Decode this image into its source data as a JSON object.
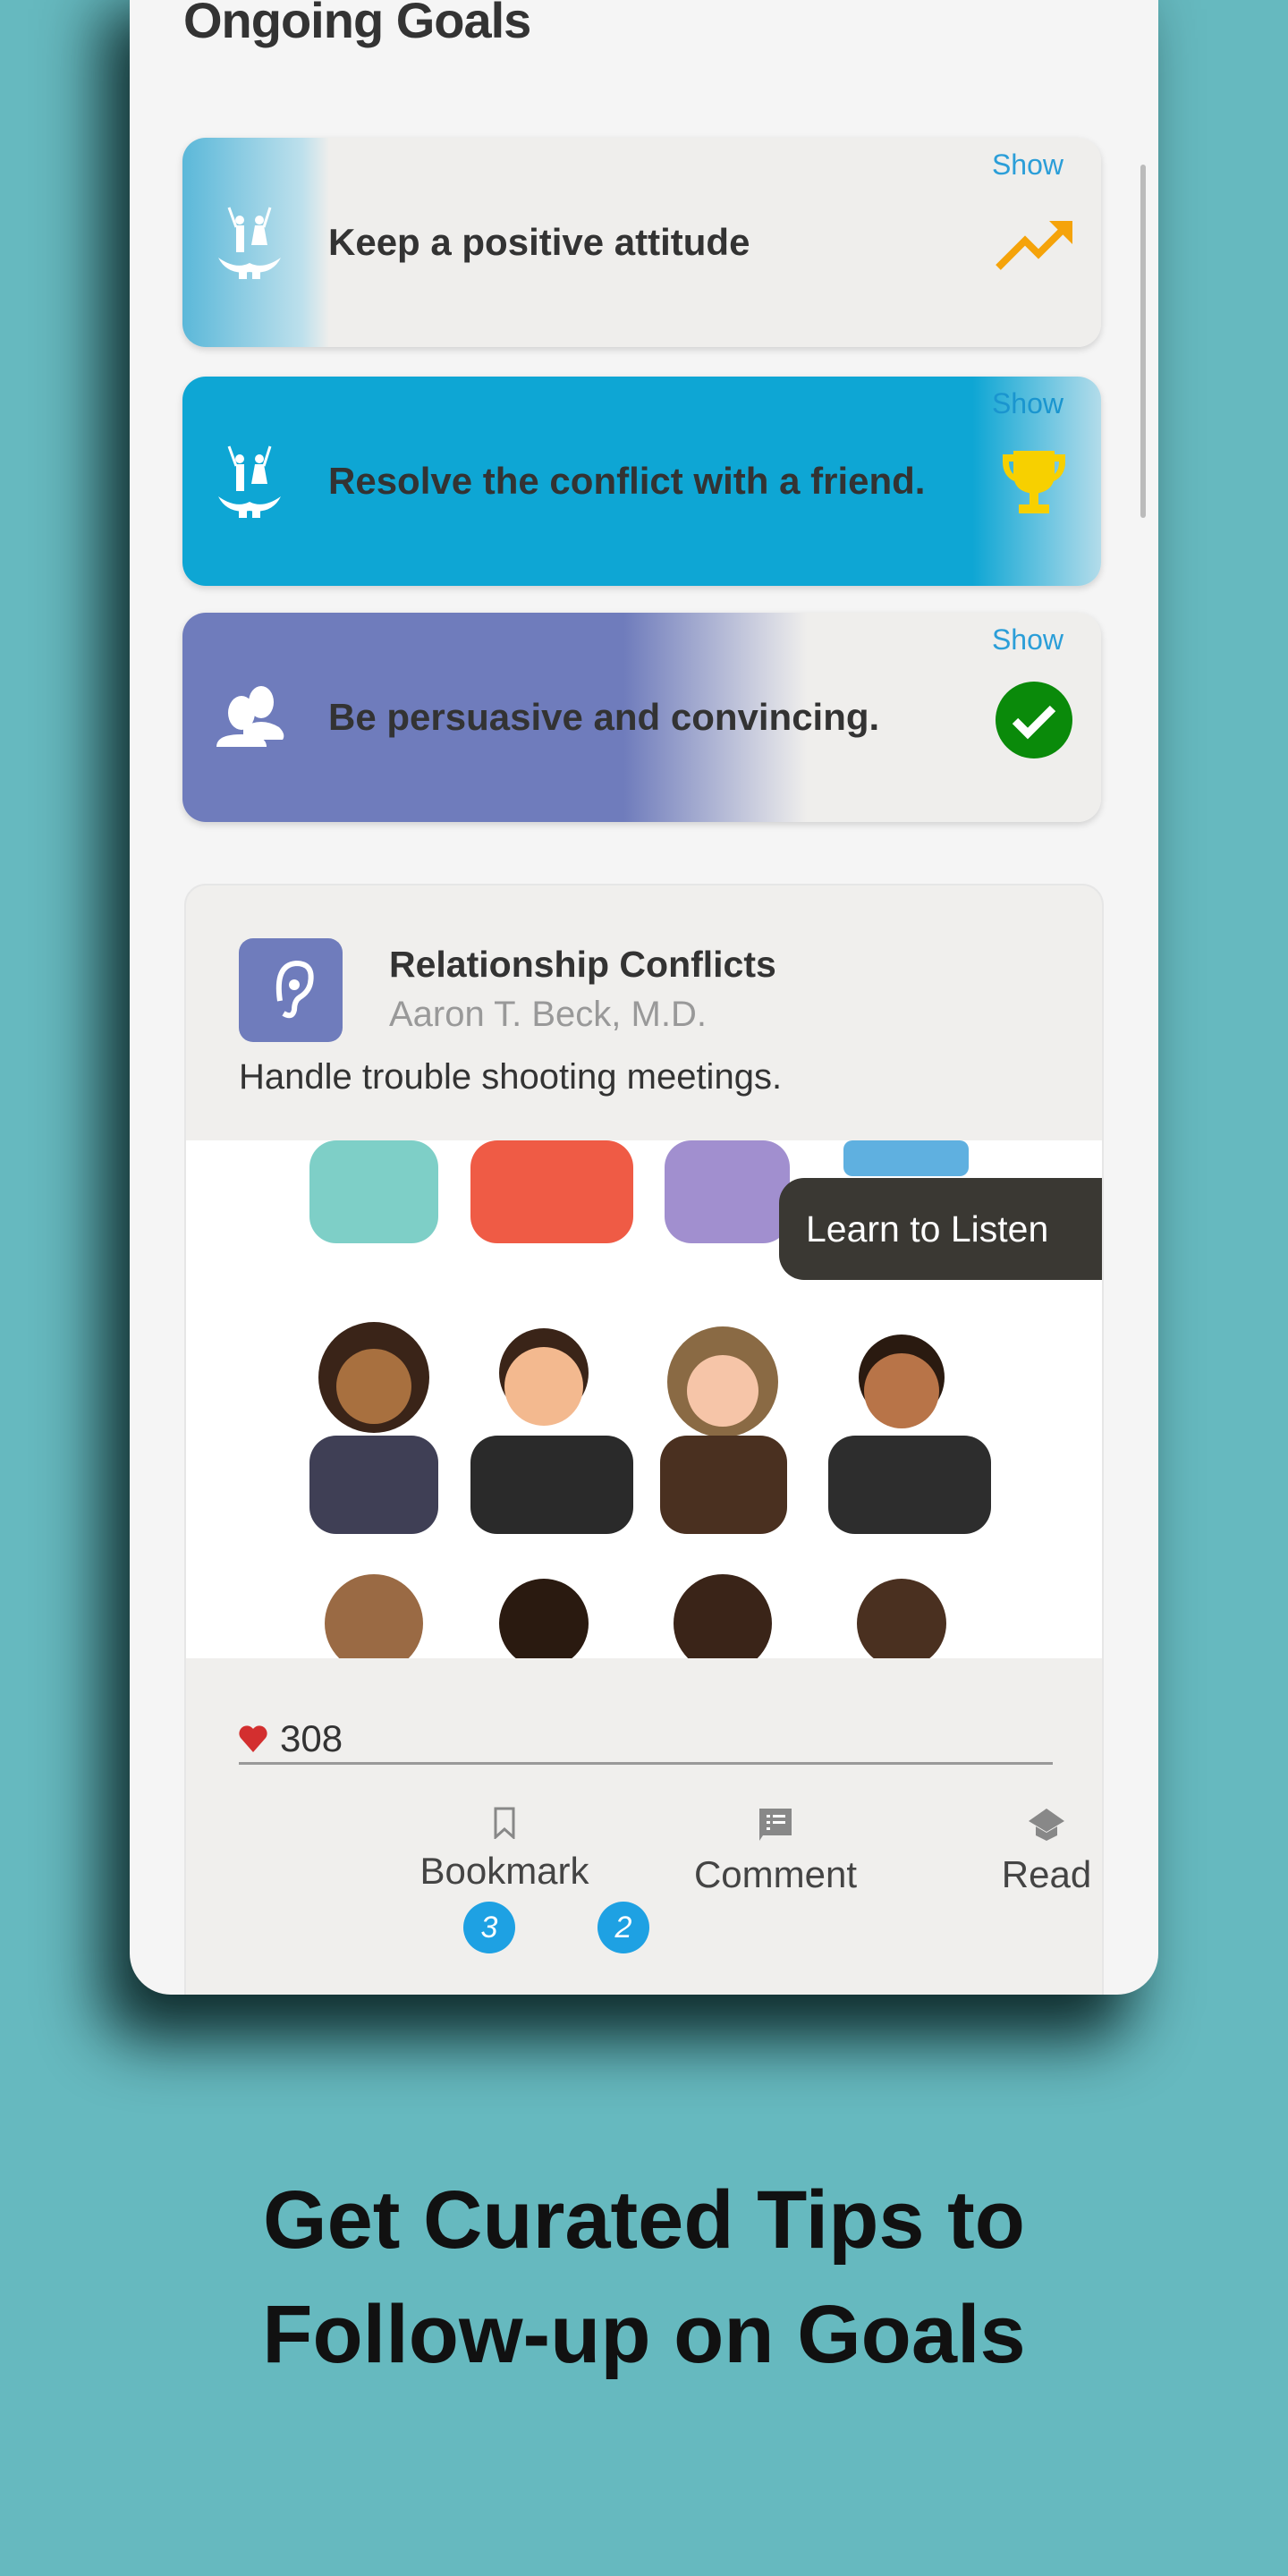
{
  "page": {
    "title": "Ongoing Goals"
  },
  "goals": [
    {
      "label": "Keep a positive attitude",
      "show": "Show",
      "icon": "family-hands-icon",
      "status_icon": "trending-up-icon",
      "status_color": "#f5a30a"
    },
    {
      "label": "Resolve the conflict with a friend.",
      "show": "Show",
      "icon": "family-hands-icon",
      "status_icon": "trophy-icon",
      "status_color": "#f7d000"
    },
    {
      "label": "Be persuasive and convincing.",
      "show": "Show",
      "icon": "people-icon",
      "status_icon": "check-circle-icon",
      "status_color": "#0a8a0a"
    }
  ],
  "article": {
    "title": "Relationship Conflicts",
    "author": "Aaron T. Beck, M.D.",
    "description": "Handle trouble shooting meetings.",
    "tooltip": "Learn to Listen",
    "likes": "308",
    "actions": [
      {
        "label": "Bookmark"
      },
      {
        "label": "Comment"
      },
      {
        "label": "Read"
      }
    ],
    "badges": [
      "3",
      "2"
    ]
  },
  "caption": {
    "line1": "Get Curated Tips to",
    "line2": "Follow-up on Goals"
  },
  "colors": {
    "background": "#66b9bf",
    "accent": "#1ea1e3",
    "heart": "#d32f2f"
  }
}
